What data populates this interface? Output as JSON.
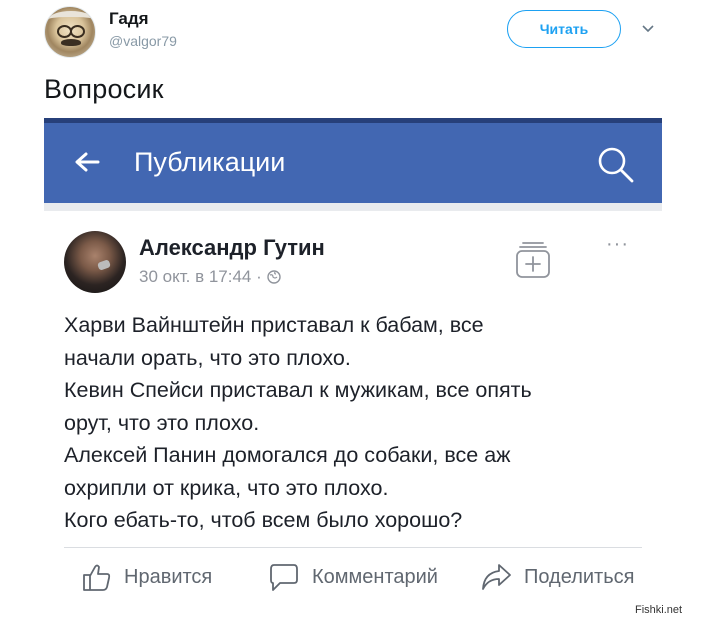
{
  "tweet": {
    "author_name": "Гадя",
    "handle": "@valgor79",
    "follow_label": "Читать",
    "text": "Вопросик",
    "avatar_icon": "cartoon-avatar"
  },
  "fb": {
    "header_title": "Публикации",
    "author": "Александр Гутин",
    "timestamp": "30 окт. в 17:44 ·",
    "post_lines": [
      "Харви Вайнштейн приставал к бабам, все",
      "начали орать, что это плохо.",
      "Кевин Спейси приставал к мужикам, все опять",
      "орут, что это плохо.",
      "Алексей Панин домогался до собаки, все аж",
      "охрипли от крика, что это плохо.",
      "Кого ебать-то, чтоб всем было хорошо?"
    ],
    "actions": {
      "like": "Нравится",
      "comment": "Комментарий",
      "share": "Поделиться"
    },
    "more_label": "···",
    "colors": {
      "bar": "#4267b2",
      "background": "#e9ebee"
    }
  },
  "watermark": "Fishki.net"
}
